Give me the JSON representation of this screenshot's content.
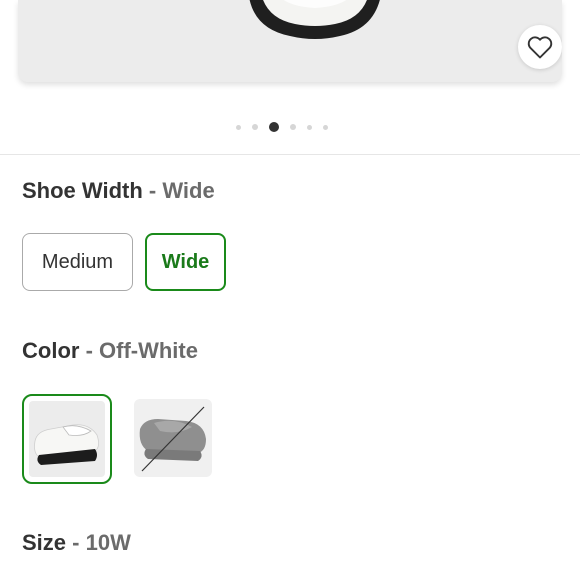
{
  "carousel": {
    "total_dots": 6,
    "active_index": 2
  },
  "shoe_width": {
    "label": "Shoe Width",
    "separator": " - ",
    "selected": "Wide",
    "options": [
      "Medium",
      "Wide"
    ]
  },
  "color": {
    "label": "Color",
    "separator": " - ",
    "selected": "Off-White",
    "swatches": [
      {
        "name": "off-white-loafer",
        "state": "selected"
      },
      {
        "name": "gray-loafer",
        "state": "unavailable"
      }
    ]
  },
  "size": {
    "label": "Size",
    "separator": " - ",
    "selected": "10W"
  },
  "icons": {
    "favorite": "heart-outline-icon"
  },
  "colors": {
    "selected_border": "#1a8a1a",
    "unselected_border": "#aaaaaa"
  }
}
